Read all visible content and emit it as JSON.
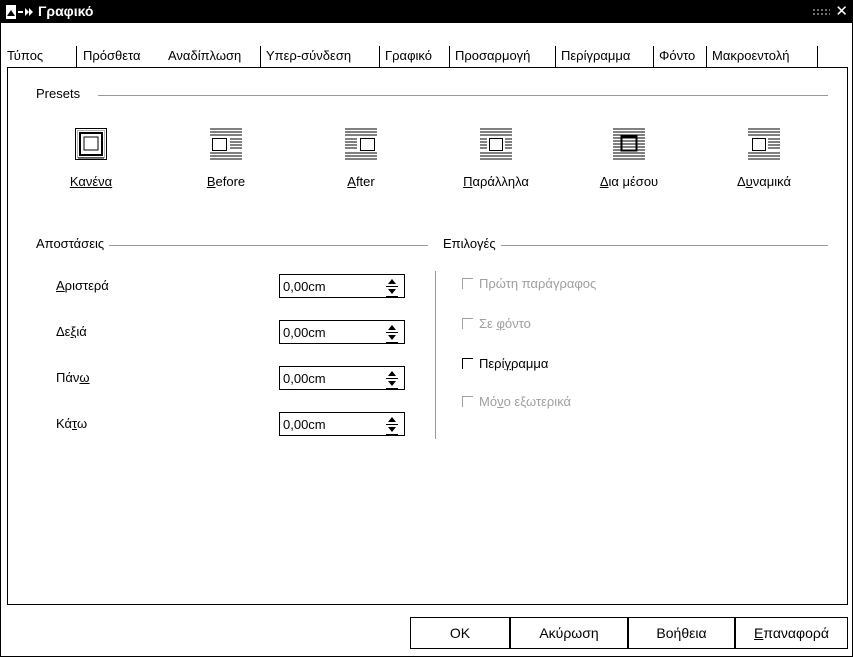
{
  "window": {
    "title": "Γραφικό"
  },
  "tabs": [
    {
      "label": "Τύπος"
    },
    {
      "label": "Πρόσθετα"
    },
    {
      "label": "Αναδίπλωση"
    },
    {
      "label": "Υπερ-σύνδεση"
    },
    {
      "label": "Γραφικό"
    },
    {
      "label": "Προσαρμογή"
    },
    {
      "label": "Περίγραμμα"
    },
    {
      "label": "Φόντο"
    },
    {
      "label": "Μακροεντολή"
    }
  ],
  "presets": {
    "heading": "Presets",
    "items": [
      {
        "label": "Κανένα",
        "icon": "wrap-none-icon"
      },
      {
        "label": "Before",
        "icon": "wrap-before-icon"
      },
      {
        "label": "After",
        "icon": "wrap-after-icon"
      },
      {
        "label": "Παράλληλα",
        "icon": "wrap-parallel-icon"
      },
      {
        "label": "Δια μέσου",
        "icon": "wrap-through-icon"
      },
      {
        "label": "Δυναμικά",
        "icon": "wrap-optimal-icon"
      }
    ]
  },
  "spacing": {
    "heading": "Αποστάσεις",
    "fields": [
      {
        "label": "Αριστερά",
        "value": "0,00cm"
      },
      {
        "label": "Δεξιά",
        "value": "0,00cm"
      },
      {
        "label": "Πάνω",
        "value": "0,00cm"
      },
      {
        "label": "Κάτω",
        "value": "0,00cm"
      }
    ]
  },
  "options": {
    "heading": "Επιλογές",
    "items": [
      {
        "label": "Πρώτη παράγραφος",
        "checked": false,
        "enabled": false
      },
      {
        "label": "Σε φόντο",
        "checked": false,
        "enabled": false
      },
      {
        "label": "Περίγραμμα",
        "checked": false,
        "enabled": true
      },
      {
        "label": "Μόνο εξωτερικά",
        "checked": false,
        "enabled": false
      }
    ]
  },
  "buttons": {
    "ok": "OK",
    "cancel": "Ακύρωση",
    "help": "Βοήθεια",
    "reset": "Επαναφορά"
  }
}
